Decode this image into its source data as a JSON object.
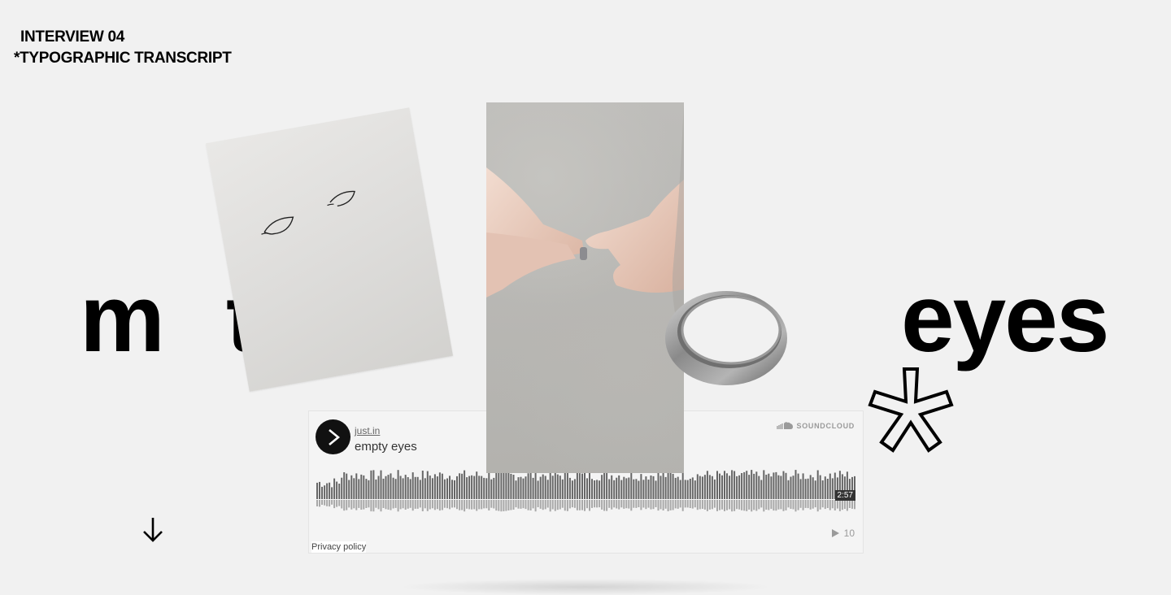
{
  "header": {
    "line1": "INTERVIEW 04",
    "line2": "*TYPOGRAPHIC TRANSCRIPT"
  },
  "words": {
    "first": "m",
    "second": "t",
    "third": "eyes"
  },
  "player": {
    "artist": "just.in",
    "track": "empty eyes",
    "brand": "SOUNDCLOUD",
    "duration": "2:57",
    "plays": "10",
    "privacy": "Privacy policy"
  },
  "icons": {
    "play": "play-icon",
    "cloud": "soundcloud-cloud-icon",
    "plays": "play-count-icon",
    "scroll": "arrow-down-icon",
    "asterisk": "asterisk-outline-icon"
  },
  "colors": {
    "background": "#f1f1f1",
    "text": "#000000",
    "player_bg": "#f4f4f4",
    "wave_dark": "#666666",
    "wave_light": "#a8a8a8"
  }
}
